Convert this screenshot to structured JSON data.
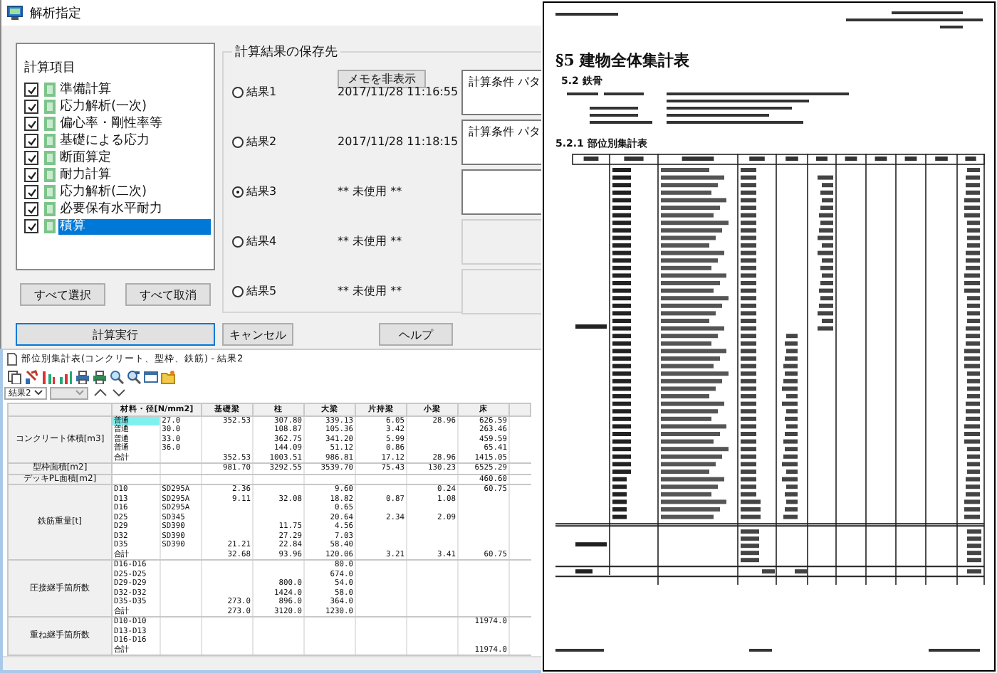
{
  "dialog": {
    "title": "解析指定",
    "items_group": {
      "label": "計算項目",
      "items": [
        {
          "label": "準備計算",
          "checked": true,
          "selected": false
        },
        {
          "label": "応力解析(一次)",
          "checked": true,
          "selected": false
        },
        {
          "label": "偏心率・剛性率等",
          "checked": true,
          "selected": false
        },
        {
          "label": "基礎による応力",
          "checked": true,
          "selected": false
        },
        {
          "label": "断面算定",
          "checked": true,
          "selected": false
        },
        {
          "label": "耐力計算",
          "checked": true,
          "selected": false
        },
        {
          "label": "応力解析(二次)",
          "checked": true,
          "selected": false
        },
        {
          "label": "必要保有水平耐力",
          "checked": true,
          "selected": false
        },
        {
          "label": "積算",
          "checked": true,
          "selected": true
        }
      ]
    },
    "select_all": "すべて選択",
    "clear_all": "すべて取消",
    "results_group": {
      "label": "計算結果の保存先",
      "memo_button": "メモを非表示",
      "slots": [
        {
          "label": "結果1",
          "selected": false,
          "timestamp": "2017/11/28 11:16:55",
          "memo": "計算条件 パタ",
          "enabled": true
        },
        {
          "label": "結果2",
          "selected": false,
          "timestamp": "2017/11/28 11:18:15",
          "memo": "計算条件 パタ",
          "enabled": true
        },
        {
          "label": "結果3",
          "selected": true,
          "timestamp": "** 未使用 **",
          "enabled": true
        },
        {
          "label": "結果4",
          "selected": false,
          "timestamp": "** 未使用 **",
          "enabled": false
        },
        {
          "label": "結果5",
          "selected": false,
          "timestamp": "** 未使用 **",
          "enabled": false
        }
      ]
    },
    "buttons": [
      {
        "label": "計算実行",
        "default": true
      },
      {
        "label": "キャンセル",
        "default": false
      },
      {
        "label": "ヘルプ",
        "default": false
      }
    ]
  },
  "table_window": {
    "title": "部位別集計表(コンクリート、型枠、鉄筋) - 結果2",
    "result_select": "結果2",
    "columns": [
      "材料・径[N/mm2]",
      "基礎梁",
      "柱",
      "大梁",
      "片持梁",
      "小梁",
      "床"
    ],
    "groups": [
      {
        "label": "コンクリート体積[m3]",
        "rows": [
          {
            "selected": true,
            "cells": [
              "普通",
              "27.0",
              "352.53",
              "307.80",
              "339.13",
              "6.05",
              "28.96",
              "626.59"
            ]
          },
          {
            "selected": false,
            "cells": [
              "普通",
              "30.0",
              null,
              "108.87",
              "105.36",
              "3.42",
              null,
              "263.46"
            ]
          },
          {
            "selected": false,
            "cells": [
              "普通",
              "33.0",
              null,
              "362.75",
              "341.20",
              "5.99",
              null,
              "459.59"
            ]
          },
          {
            "selected": false,
            "cells": [
              "普通",
              "36.0",
              null,
              "144.09",
              "51.12",
              "0.86",
              null,
              "65.41"
            ]
          },
          {
            "selected": false,
            "cells": [
              "合計",
              null,
              "352.53",
              "1003.51",
              "986.81",
              "17.12",
              "28.96",
              "1415.05"
            ]
          }
        ]
      },
      {
        "label": "型枠面積[m2]",
        "rows": [
          {
            "selected": false,
            "cells": [
              null,
              null,
              "981.70",
              "3292.55",
              "3539.70",
              "75.43",
              "130.23",
              "6525.29"
            ]
          }
        ]
      },
      {
        "label": "デッキPL面積[m2]",
        "rows": [
          {
            "selected": false,
            "cells": [
              null,
              null,
              null,
              null,
              null,
              null,
              null,
              "460.60"
            ]
          }
        ]
      },
      {
        "label": "鉄筋重量[t]",
        "rows": [
          {
            "selected": false,
            "cells": [
              "D10",
              "SD295A",
              "2.36",
              null,
              "9.60",
              null,
              "0.24",
              "60.75"
            ]
          },
          {
            "selected": false,
            "cells": [
              "D13",
              "SD295A",
              "9.11",
              "32.08",
              "18.82",
              "0.87",
              "1.08",
              null
            ]
          },
          {
            "selected": false,
            "cells": [
              "D16",
              "SD295A",
              null,
              null,
              "0.65",
              null,
              null,
              null
            ]
          },
          {
            "selected": false,
            "cells": [
              "D25",
              "SD345",
              null,
              null,
              "20.64",
              "2.34",
              "2.09",
              null
            ]
          },
          {
            "selected": false,
            "cells": [
              "D29",
              "SD390",
              null,
              "11.75",
              "4.56",
              null,
              null,
              null
            ]
          },
          {
            "selected": false,
            "cells": [
              "D32",
              "SD390",
              null,
              "27.29",
              "7.03",
              null,
              null,
              null
            ]
          },
          {
            "selected": false,
            "cells": [
              "D35",
              "SD390",
              "21.21",
              "22.84",
              "58.40",
              null,
              null,
              null
            ]
          },
          {
            "selected": false,
            "cells": [
              "合計",
              null,
              "32.68",
              "93.96",
              "120.06",
              "3.21",
              "3.41",
              "60.75"
            ]
          }
        ]
      },
      {
        "label": "圧接継手箇所数",
        "rows": [
          {
            "selected": false,
            "cells": [
              "D16-D16",
              null,
              null,
              null,
              "80.0",
              null,
              null,
              null
            ]
          },
          {
            "selected": false,
            "cells": [
              "D25-D25",
              null,
              null,
              null,
              "674.0",
              null,
              null,
              null
            ]
          },
          {
            "selected": false,
            "cells": [
              "D29-D29",
              null,
              null,
              "800.0",
              "54.0",
              null,
              null,
              null
            ]
          },
          {
            "selected": false,
            "cells": [
              "D32-D32",
              null,
              null,
              "1424.0",
              "58.0",
              null,
              null,
              null
            ]
          },
          {
            "selected": false,
            "cells": [
              "D35-D35",
              null,
              "273.0",
              "896.0",
              "364.0",
              null,
              null,
              null
            ]
          },
          {
            "selected": false,
            "cells": [
              "合計",
              null,
              "273.0",
              "3120.0",
              "1230.0",
              null,
              null,
              null
            ]
          }
        ]
      },
      {
        "label": "重ね継手箇所数",
        "rows": [
          {
            "selected": false,
            "cells": [
              "D10-D10",
              null,
              null,
              null,
              null,
              null,
              null,
              "11974.0"
            ]
          },
          {
            "selected": false,
            "cells": [
              "D13-D13",
              null,
              null,
              null,
              null,
              null,
              null,
              null
            ]
          },
          {
            "selected": false,
            "cells": [
              "D16-D16",
              null,
              null,
              null,
              null,
              null,
              null,
              null
            ]
          },
          {
            "selected": false,
            "cells": [
              "合計",
              null,
              null,
              null,
              null,
              null,
              null,
              "11974.0"
            ]
          }
        ]
      }
    ]
  },
  "report": {
    "title": "§5 建物全体集計表",
    "section": "5.2 鉄骨",
    "subsection": "5.2.1 部位別集計表"
  }
}
